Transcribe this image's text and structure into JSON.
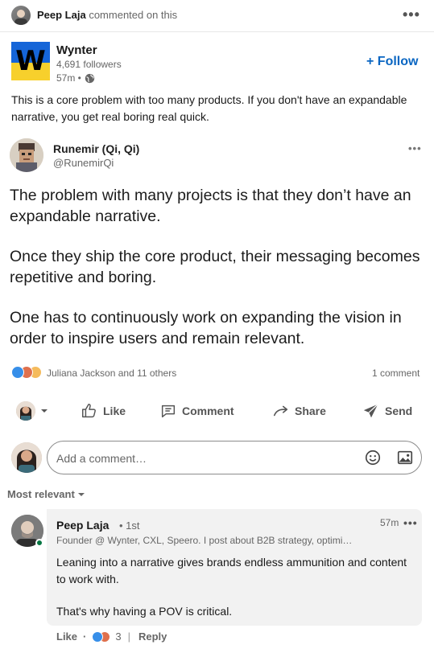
{
  "activity": {
    "actor": "Peep Laja",
    "action": "commented on this",
    "menu": "•••"
  },
  "company": {
    "name": "Wynter",
    "logo_letter": "W",
    "followers": "4,691 followers",
    "time": "57m •",
    "follow_label": "+ Follow"
  },
  "post_text": "This is a core problem with too many products. If you don't have an expandable narrative, you get real boring real quick.",
  "tweet": {
    "name": "Runemir (Qi, Qi)",
    "handle": "@RunemirQi",
    "menu": "•••",
    "paragraphs": [
      "The problem with many projects is that they don’t have an expandable narrative.",
      "Once they ship the core product, their messaging becomes repetitive and boring.",
      "One has to continuously work on expanding the vision in order to inspire users and remain relevant."
    ]
  },
  "social": {
    "reactions_text": "Juliana Jackson and 11 others",
    "comments_text": "1 comment"
  },
  "actions": {
    "like": "Like",
    "comment": "Comment",
    "share": "Share",
    "send": "Send"
  },
  "comment_box": {
    "placeholder": "Add a comment…"
  },
  "sort_label": "Most relevant",
  "comment": {
    "name": "Peep Laja",
    "degree": "• 1st",
    "time": "57m",
    "menu": "•••",
    "headline": "Founder @ Wynter, CXL, Speero. I post about B2B strategy, optimi…",
    "paragraphs": [
      "Leaning into a narrative gives brands endless ammunition and content to work with.",
      "That's why having a POV is critical."
    ],
    "like": "Like",
    "separator": "·",
    "reaction_count": "3",
    "divider": "|",
    "reply": "Reply"
  },
  "colors": {
    "brand_blue": "#0a66c2",
    "logo_blue": "#1565d8",
    "logo_yellow": "#f7d02c",
    "online_green": "#057642"
  }
}
